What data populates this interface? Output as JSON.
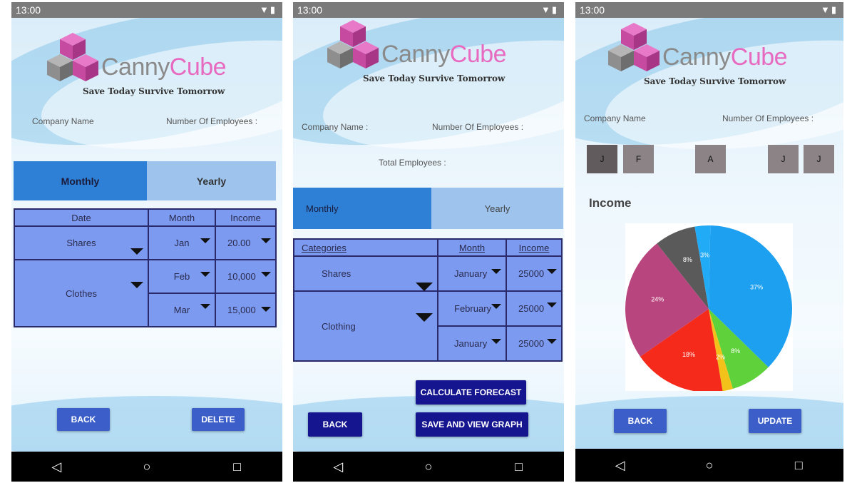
{
  "status_time": "13:00",
  "status_icons": "▼▮",
  "nav": {
    "back": "◁",
    "home": "○",
    "recent": "□"
  },
  "brand": {
    "canny": "Canny",
    "cube": "Cube",
    "tagline": "Save Today Survive Tomorrow"
  },
  "screen1": {
    "company_label": "Company Name",
    "employees_label": "Number Of Employees :",
    "tab_monthly": "Monthly",
    "tab_yearly": "Yearly",
    "headers": [
      "Date",
      "Month",
      "Income"
    ],
    "categories": [
      "Shares",
      "Clothes"
    ],
    "months": [
      "Jan",
      "Feb",
      "Mar"
    ],
    "incomes": [
      "20.00",
      "10,000",
      "15,000"
    ],
    "back": "BACK",
    "delete": "DELETE"
  },
  "screen2": {
    "company_label": "Company Name :",
    "employees_label": "Number Of Employees :",
    "total_label": "Total Employees :",
    "tab_monthly": "Monthly",
    "tab_yearly": "Yearly",
    "headers": [
      "Categories",
      "Month",
      "Income"
    ],
    "categories": [
      "Shares",
      "Clothing"
    ],
    "months": [
      "January",
      "February",
      "January"
    ],
    "incomes": [
      "25000",
      "25000",
      "25000"
    ],
    "calc": "CALCULATE FORECAST",
    "back": "BACK",
    "save": "SAVE AND VIEW GRAPH"
  },
  "screen3": {
    "company_label": "Company Name",
    "employees_label": "Number Of Employees :",
    "month_buttons": [
      "J",
      "F",
      "A",
      "J",
      "J"
    ],
    "income_title": "Income",
    "back": "BACK",
    "update": "UPDATE"
  },
  "chart_data": {
    "type": "pie",
    "title": "Income",
    "labels": [
      "37%",
      "8%",
      "2%",
      "18%",
      "24%",
      "8%",
      "3%"
    ],
    "values": [
      37,
      8,
      2,
      18,
      24,
      8,
      3
    ],
    "colors": [
      "#1ea0f0",
      "#5fd13a",
      "#f2c21a",
      "#f52a1a",
      "#b9457e",
      "#5a5a5a",
      "#21aaf5"
    ]
  }
}
